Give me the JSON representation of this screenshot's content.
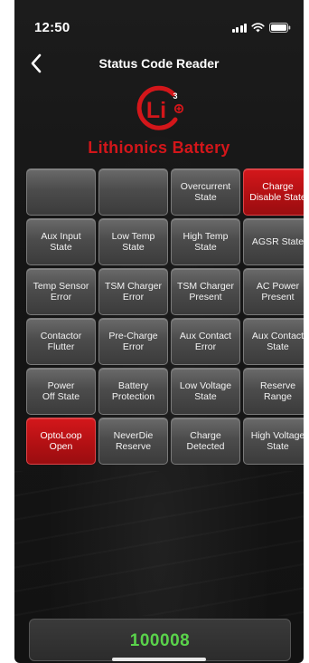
{
  "status_bar": {
    "time": "12:50",
    "icons": [
      "signal-icon",
      "wifi-icon",
      "battery-icon"
    ]
  },
  "nav": {
    "back_icon": "chevron-left-icon",
    "title": "Status Code Reader"
  },
  "logo": {
    "mark_text": "Li",
    "superscript": "3",
    "brand_name": "Lithionics Battery"
  },
  "colors": {
    "background": "#151515",
    "tile_gray": "#4c4c4c",
    "tile_active_red": "#b01013",
    "brand_red": "#d3161a",
    "code_green": "#5ad34b"
  },
  "tiles": [
    {
      "line1": "",
      "line2": "",
      "active": false
    },
    {
      "line1": "",
      "line2": "",
      "active": false
    },
    {
      "line1": "Overcurrent",
      "line2": "State",
      "active": false
    },
    {
      "line1": "Charge",
      "line2": "Disable State",
      "active": true
    },
    {
      "line1": "Aux Input",
      "line2": "State",
      "active": false
    },
    {
      "line1": "Low Temp",
      "line2": "State",
      "active": false
    },
    {
      "line1": "High Temp",
      "line2": "State",
      "active": false
    },
    {
      "line1": "AGSR State",
      "line2": "",
      "active": false
    },
    {
      "line1": "Temp Sensor",
      "line2": "Error",
      "active": false
    },
    {
      "line1": "TSM Charger",
      "line2": "Error",
      "active": false
    },
    {
      "line1": "TSM Charger",
      "line2": "Present",
      "active": false
    },
    {
      "line1": "AC Power",
      "line2": "Present",
      "active": false
    },
    {
      "line1": "Contactor",
      "line2": "Flutter",
      "active": false
    },
    {
      "line1": "Pre-Charge",
      "line2": "Error",
      "active": false
    },
    {
      "line1": "Aux Contact",
      "line2": "Error",
      "active": false
    },
    {
      "line1": "Aux Contact",
      "line2": "State",
      "active": false
    },
    {
      "line1": "Power",
      "line2": "Off State",
      "active": false
    },
    {
      "line1": "Battery",
      "line2": "Protection",
      "active": false
    },
    {
      "line1": "Low Voltage",
      "line2": "State",
      "active": false
    },
    {
      "line1": "Reserve",
      "line2": "Range",
      "active": false
    },
    {
      "line1": "OptoLoop",
      "line2": "Open",
      "active": true
    },
    {
      "line1": "NeverDie",
      "line2": "Reserve",
      "active": false
    },
    {
      "line1": "Charge",
      "line2": "Detected",
      "active": false
    },
    {
      "line1": "High Voltage",
      "line2": "State",
      "active": false
    }
  ],
  "status_code": {
    "value": "100008"
  }
}
